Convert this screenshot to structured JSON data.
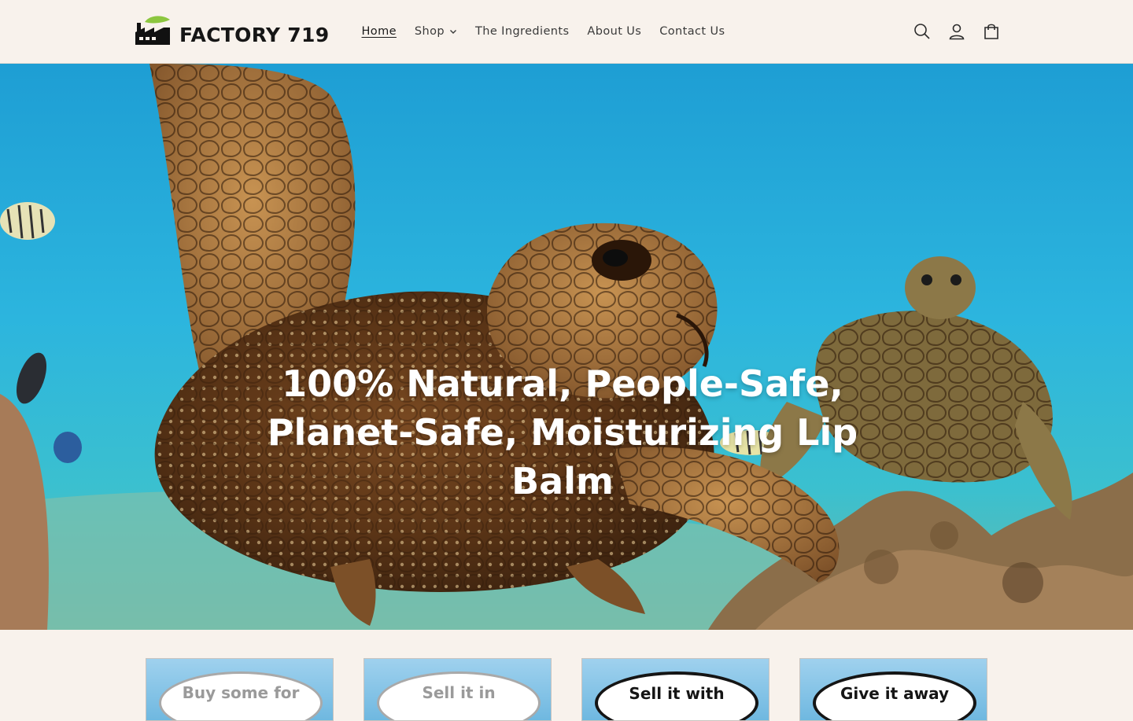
{
  "brand": {
    "name": "FACTORY 719"
  },
  "nav": {
    "items": [
      {
        "label": "Home",
        "active": true
      },
      {
        "label": "Shop",
        "has_dropdown": true
      },
      {
        "label": "The Ingredients"
      },
      {
        "label": "About Us"
      },
      {
        "label": "Contact Us"
      }
    ]
  },
  "header_icons": [
    "search-icon",
    "account-icon",
    "cart-icon"
  ],
  "hero": {
    "title": "100% Natural, People-Safe, Planet-Safe, Moisturizing Lip Balm"
  },
  "cards": [
    {
      "label": "Buy some for",
      "style": "light"
    },
    {
      "label": "Sell it in",
      "style": "light"
    },
    {
      "label": "Sell it with",
      "style": "dark"
    },
    {
      "label": "Give it away",
      "style": "dark"
    }
  ],
  "colors": {
    "background": "#f8f2ec",
    "text": "#2b2b2b",
    "logo_leaf": "#8cc63f",
    "hero_text": "#ffffff"
  }
}
